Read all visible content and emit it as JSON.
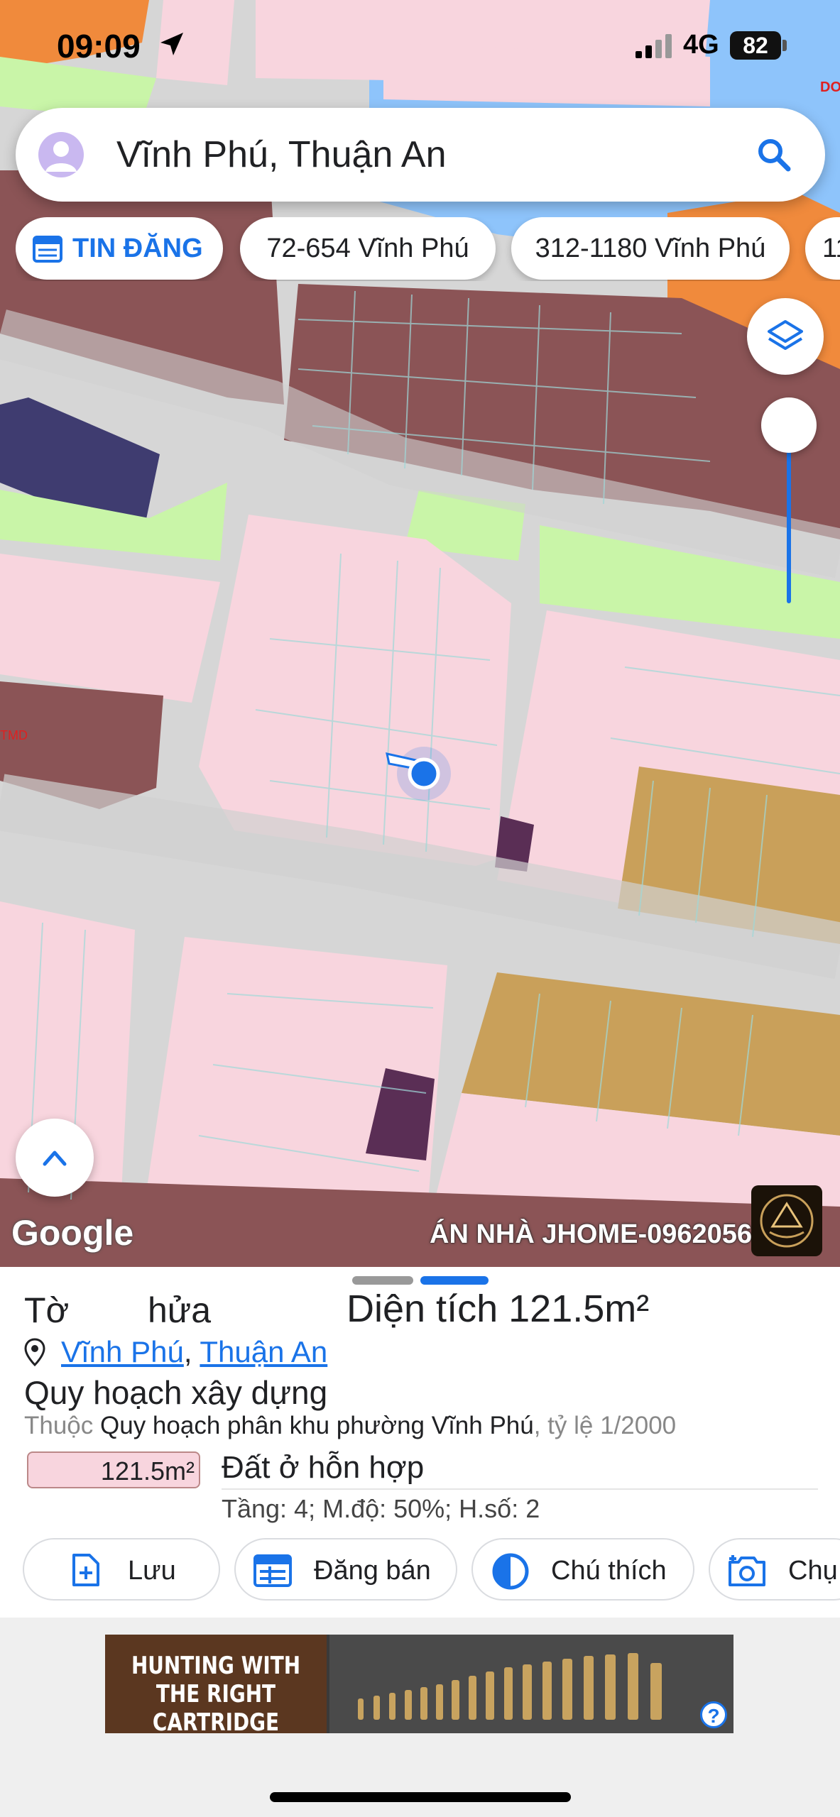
{
  "status_bar": {
    "time": "09:09",
    "network": "4G",
    "battery": "82"
  },
  "search": {
    "query": "Vĩnh Phú, Thuận An"
  },
  "chips": [
    {
      "label": "TIN ĐĂNG"
    },
    {
      "label": "72-654 Vĩnh Phú"
    },
    {
      "label": "312-1180 Vĩnh Phú"
    },
    {
      "label": "11"
    }
  ],
  "map": {
    "attribution": "Google",
    "watermark": "ÁN NHÀ JHOME-0962056",
    "label_red": "TMD",
    "top_right_label": "DO"
  },
  "parcel": {
    "to_label": "Tờ",
    "thua_label": "hửa",
    "area_label": "Diện tích",
    "area_value": "121.5m²",
    "ward": "Vĩnh Phú",
    "city": "Thuận An",
    "separator": ",",
    "plan_title": "Quy hoạch xây dựng",
    "plan_prefix": "Thuộc",
    "plan_name": "Quy hoạch phân khu phường Vĩnh Phú",
    "plan_scale": ", tỷ lệ 1/2000",
    "land_area": "121.5m²",
    "land_type": "Đất ở hỗn hợp",
    "land_detail": "Tầng: 4; M.độ: 50%; H.số: 2"
  },
  "actions": [
    {
      "label": "Lưu"
    },
    {
      "label": "Đăng bán"
    },
    {
      "label": "Chú thích"
    },
    {
      "label": "Chụ"
    }
  ],
  "ad": {
    "text": "HUNTING WITH THE RIGHT CARTRIDGE",
    "help": "?"
  },
  "colors": {
    "accent": "#1a73e8",
    "residential": "#f8d5de",
    "commercial": "#8b5456",
    "green": "#c9f5a8",
    "water": "#8ec4fb",
    "ochre": "#c9a05a"
  }
}
